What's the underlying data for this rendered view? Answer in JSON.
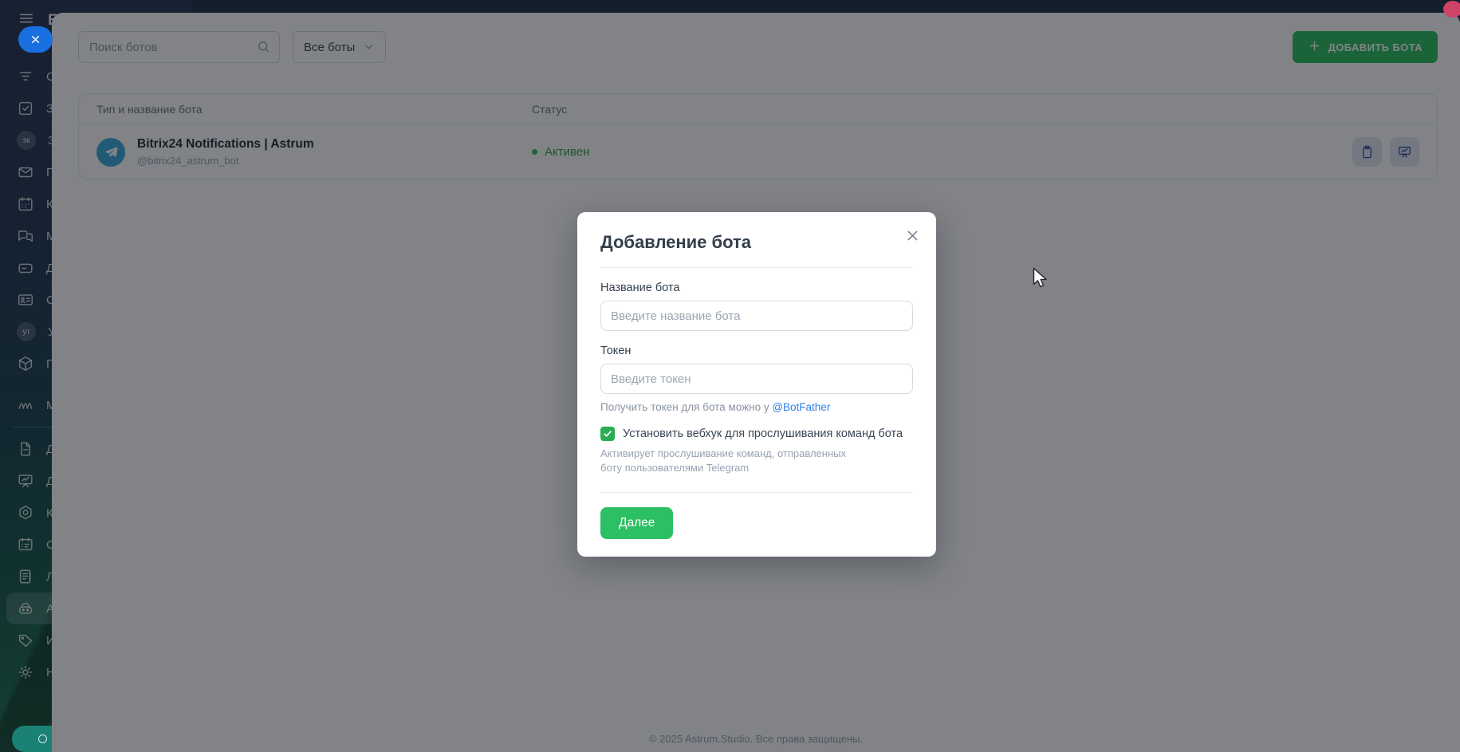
{
  "app": {
    "footer_text": "© 2025 Astrum.Studio. Все права защищены."
  },
  "sidebar": {
    "brand_initial": "Б",
    "items": [
      {
        "icon": "crm-funnel-icon",
        "label": "С"
      },
      {
        "icon": "tasks-icon",
        "label": "З"
      },
      {
        "icon": "avatar-zk",
        "avatar": "зк",
        "label": "З"
      },
      {
        "icon": "mail-icon",
        "label": "П"
      },
      {
        "icon": "calendar-icon",
        "label": "К"
      },
      {
        "icon": "messenger-icon",
        "label": "М"
      },
      {
        "icon": "wallet-icon",
        "label": "Д"
      },
      {
        "icon": "idcard-icon",
        "label": "С"
      },
      {
        "icon": "avatar-ut",
        "avatar": "ут",
        "label": "У"
      },
      {
        "icon": "box-icon",
        "label": "П"
      },
      {
        "icon": "market-waves-icon",
        "label": "М"
      },
      {
        "icon": "document-icon",
        "label": "Д"
      },
      {
        "icon": "dashboard-icon",
        "label": "Д"
      },
      {
        "icon": "hexagon-icon",
        "label": "К"
      },
      {
        "icon": "schedule-icon",
        "label": "О"
      },
      {
        "icon": "log-icon",
        "label": "Л"
      },
      {
        "icon": "robot-icon",
        "label": "А",
        "active": true
      },
      {
        "icon": "tag-icon",
        "label": "И"
      },
      {
        "icon": "gear-icon",
        "label": "Н"
      }
    ]
  },
  "toolbar": {
    "search_placeholder": "Поиск ботов",
    "filter_label": "Все боты",
    "add_button_label": "ДОБАВИТЬ БОТА"
  },
  "table": {
    "columns": {
      "name": "Тип и название бота",
      "status": "Статус"
    },
    "rows": [
      {
        "platform": "telegram",
        "name": "Bitrix24 Notifications | Astrum",
        "handle": "@bitrix24_astrum_bot",
        "status": "Активен"
      }
    ]
  },
  "modal": {
    "title": "Добавление бота",
    "fields": [
      {
        "label": "Название бота",
        "placeholder": "Введите название бота"
      },
      {
        "label": "Токен",
        "placeholder": "Введите токен"
      }
    ],
    "token_hint_text": "Получить токен для бота можно у ",
    "token_hint_link": "@BotFather",
    "checkbox": {
      "checked": true,
      "label": "Установить вебхук для прослушивания команд бота",
      "description": "Активирует прослушивание команд, отправленных боту пользователями Telegram"
    },
    "submit_label": "Далее"
  },
  "colors": {
    "accent_green": "#2bbf5e",
    "checkbox_green": "#2cab55",
    "status_green": "#31a24f",
    "telegram_blue": "#35a9dc",
    "link_blue": "#2f80ed",
    "overlay": "rgba(14,17,23,0.52)"
  }
}
